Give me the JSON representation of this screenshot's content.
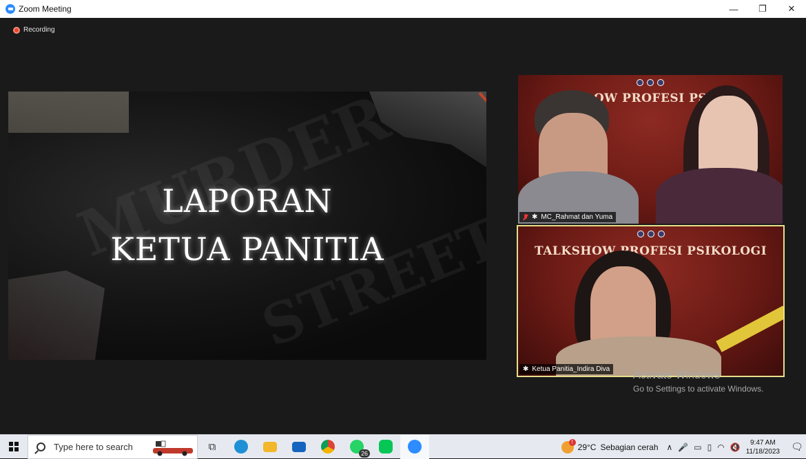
{
  "window": {
    "title": "Zoom Meeting",
    "minimize": "—",
    "restore": "❐",
    "close": "✕"
  },
  "recording": {
    "label": "Recording"
  },
  "share": {
    "line1": "LAPORAN",
    "line2": "KETUA PANITIA"
  },
  "participants": [
    {
      "name": "MC_Rahmat dan Yuma",
      "banner": "OW PROFESI PS",
      "muted": true
    },
    {
      "name": "Ketua Panitia_Indira Diva",
      "banner": "TALKSHOW PROFESI PSIKOLOGI",
      "muted": false
    }
  ],
  "watermark": {
    "line1": "Activate Windows",
    "line2": "Go to Settings to activate Windows."
  },
  "taskbar": {
    "search_placeholder": "Type here to search",
    "apps": [
      {
        "icon": "task-view-icon",
        "color": "#444444"
      },
      {
        "icon": "edge-icon",
        "color": "#1f8fd6"
      },
      {
        "icon": "file-explorer-icon",
        "color": "#f2b72a"
      },
      {
        "icon": "mail-icon",
        "color": "#1565c0"
      },
      {
        "icon": "chrome-icon",
        "color": "#db4437"
      },
      {
        "icon": "whatsapp-icon",
        "color": "#25d366",
        "badge": "26"
      },
      {
        "icon": "line-icon",
        "color": "#06c755"
      },
      {
        "icon": "zoom-icon",
        "color": "#2d8cff"
      }
    ],
    "weather": {
      "temp": "29°C",
      "desc": "Sebagian cerah"
    },
    "time": "9:47 AM",
    "date": "11/18/2023",
    "notifications": "1"
  },
  "colors": {
    "active_speaker_border": "#e7e08c",
    "zoom_blue": "#2d8cff",
    "recording_red": "#e8462d"
  }
}
